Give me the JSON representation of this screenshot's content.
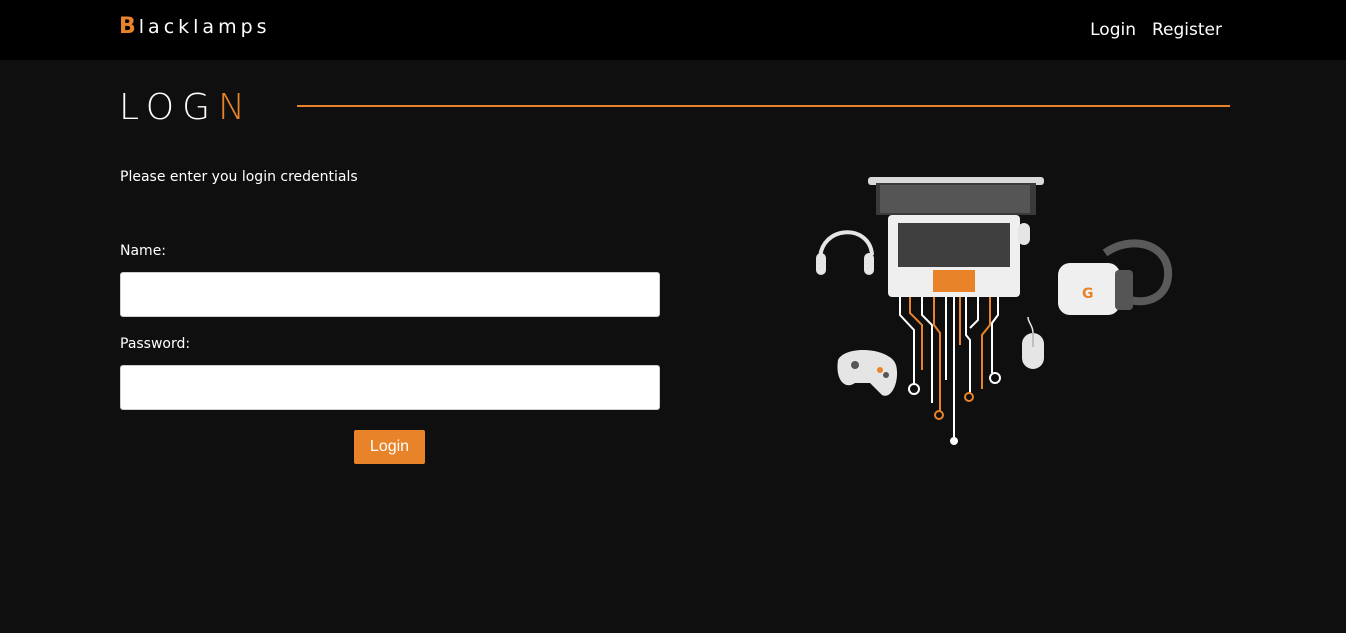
{
  "header": {
    "brand_mark": "B",
    "brand_text": "lacklamps",
    "nav": {
      "login": "Login",
      "register": "Register"
    }
  },
  "page": {
    "heading_main": "LOG",
    "heading_accent": "N",
    "intro": "Please enter you login credentials"
  },
  "form": {
    "name_label": "Name:",
    "name_value": "",
    "password_label": "Password:",
    "password_value": "",
    "submit_label": "Login"
  },
  "colors": {
    "accent": "#e8832a",
    "background": "#0f0f0f",
    "topbar": "#000000"
  },
  "illustration": {
    "icons": [
      "laptop-icon",
      "headphones-icon",
      "vr-headset-icon",
      "gamepad-icon",
      "mouse-icon"
    ]
  }
}
